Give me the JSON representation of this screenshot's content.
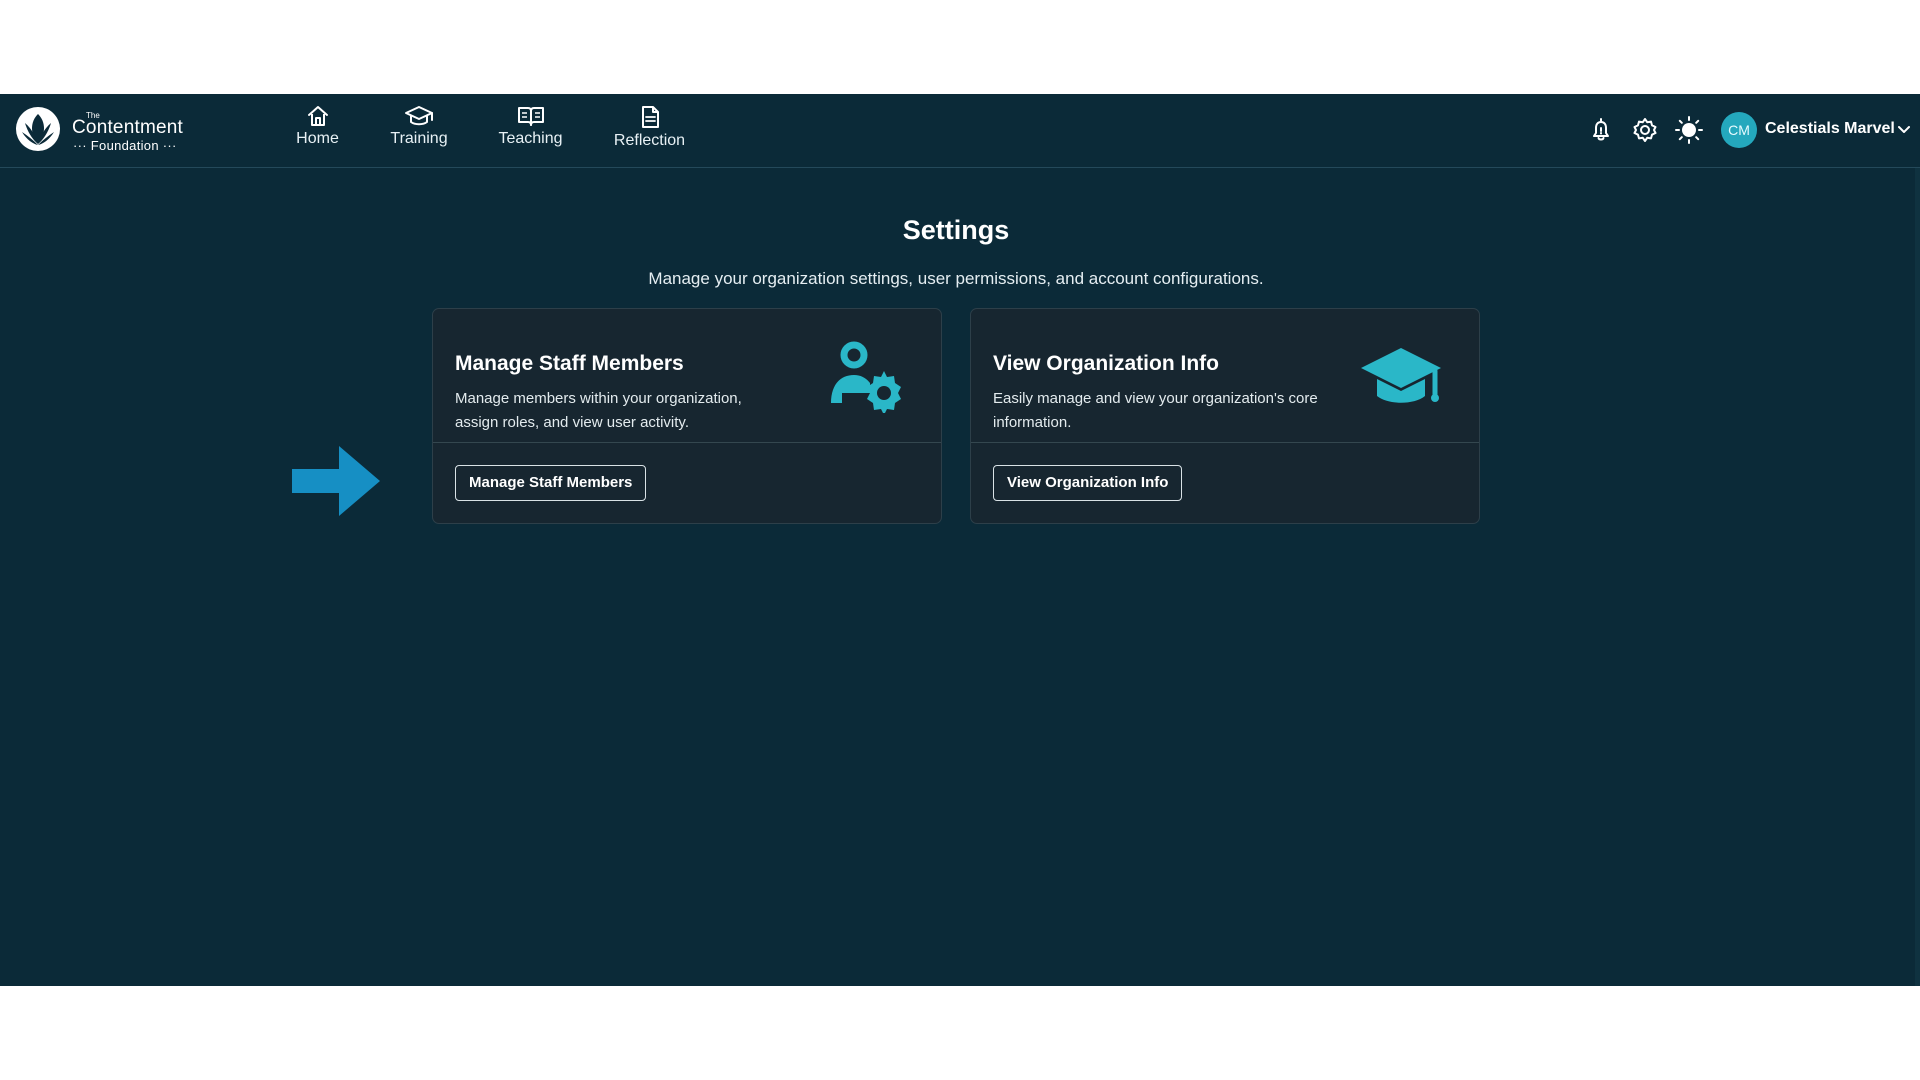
{
  "app": {
    "logo": {
      "small_word": "The",
      "name": "Contentment",
      "subtitle": "··· Foundation ···"
    },
    "nav": [
      {
        "label": "Home",
        "icon": "home-icon"
      },
      {
        "label": "Training",
        "icon": "graduation-cap-icon"
      },
      {
        "label": "Teaching",
        "icon": "open-book-icon"
      },
      {
        "label": "Reflection",
        "icon": "document-icon"
      }
    ],
    "toolbar_icons": [
      "bell-icon",
      "gear-icon",
      "sun-icon"
    ],
    "user": {
      "initials": "CM",
      "name": "Celestials Marvel",
      "menu_icon": "chevron-down-icon"
    }
  },
  "page": {
    "title": "Settings",
    "subtitle": "Manage your organization settings, user permissions, and account configurations."
  },
  "cards": [
    {
      "title": "Manage Staff Members",
      "description": "Manage members within your organization, assign roles, and view user activity.",
      "button_label": "Manage Staff Members",
      "icon": "user-gear-icon"
    },
    {
      "title": "View Organization Info",
      "description": "Easily manage and view your organization's core information.",
      "button_label": "View Organization Info",
      "icon": "graduation-cap-icon"
    }
  ],
  "annotation": {
    "icon": "right-arrow-icon"
  },
  "colors": {
    "background": "#0b2a38",
    "card": "#172630",
    "accent": "#2ab7c8",
    "arrow": "#168fc4"
  }
}
